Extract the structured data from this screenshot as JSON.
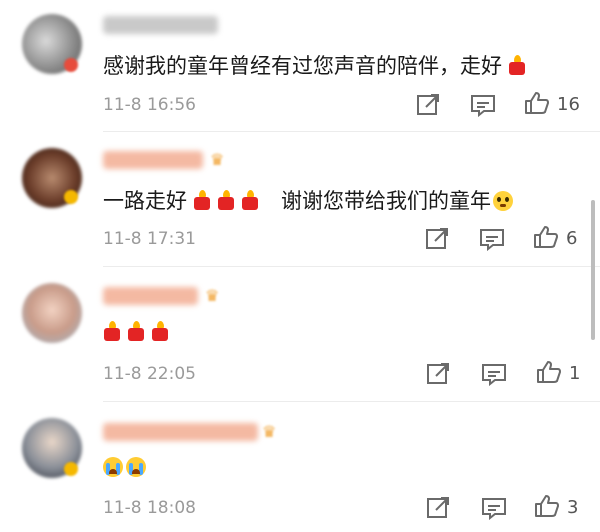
{
  "comments": [
    {
      "text": "感谢我的童年曾经有过您声音的陪伴，走好",
      "time": "11-8 16:56",
      "likes": "16",
      "emoji_after": [
        "candle-icon"
      ]
    },
    {
      "text_a": "一路走好",
      "text_b": "谢谢您带给我们的童年",
      "time": "11-8 17:31",
      "likes": "6",
      "emoji_middle": [
        "candle-icon",
        "candle-icon",
        "candle-icon"
      ],
      "emoji_after": [
        "pleading-face-icon"
      ]
    },
    {
      "time": "11-8 22:05",
      "likes": "1",
      "emoji": [
        "candle-icon",
        "candle-icon",
        "candle-icon"
      ]
    },
    {
      "time": "11-8 18:08",
      "likes": "3",
      "emoji": [
        "crying-face-icon",
        "crying-face-icon"
      ]
    }
  ],
  "colors": {
    "candle": "#e32424",
    "flame": "#ffb300",
    "time": "#9a9a9a",
    "icon": "#6a6a6a"
  }
}
